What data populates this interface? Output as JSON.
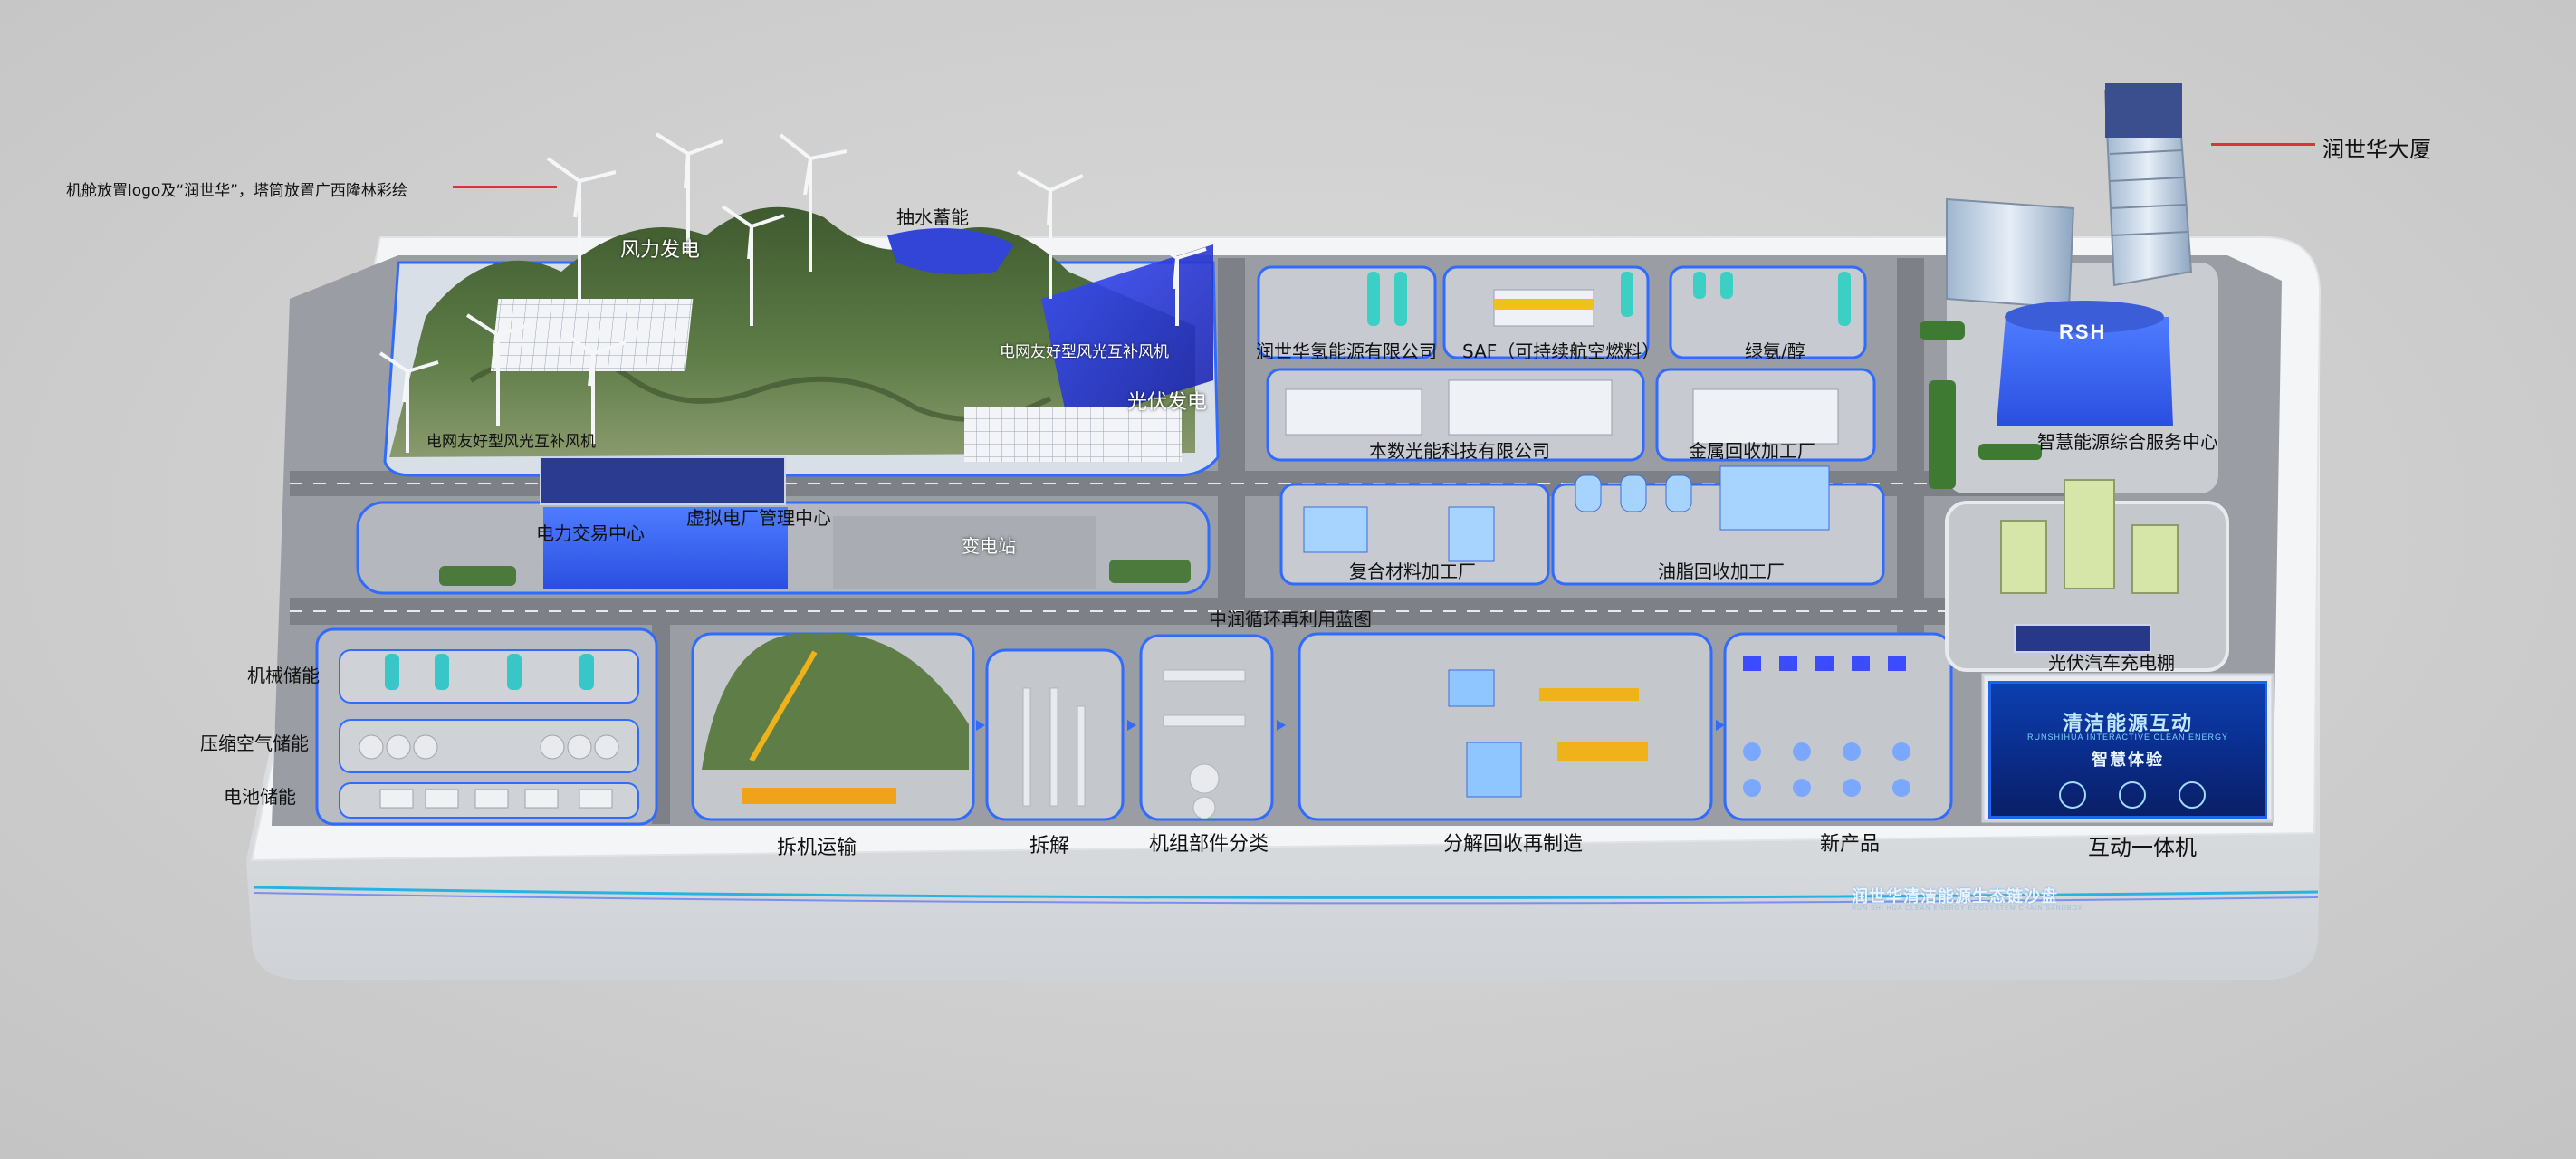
{
  "annotations": {
    "nacelle_note": "机舱放置logo及“润世华”，塔筒放置广西隆林彩绘",
    "building_callout": "润世华大厦"
  },
  "zones": {
    "wind_power": "风力发电",
    "pumped_storage": "抽水蓄能",
    "grid_friendly_wind_1": "电网友好型风光互补风机",
    "grid_friendly_wind_2": "电网友好型风光互补风机",
    "solar_power": "光伏发电",
    "power_trading_center": "电力交易中心",
    "virtual_power_plant": "虚拟电厂管理中心",
    "substation": "变电站",
    "hydrogen_company": "润世华氢能源有限公司",
    "saf": "SAF（可持续航空燃料）",
    "green_ammonia": "绿氨/醇",
    "photovoltaic_company": "本数光能科技有限公司",
    "metal_recycling": "金属回收加工厂",
    "composite_processing": "复合材料加工厂",
    "oil_recycling": "油脂回收加工厂",
    "smart_energy_center": "智慧能源综合服务中心",
    "solar_carport": "光伏汽车充电棚",
    "circular_blueprint": "中润循环再利用蓝图",
    "mechanical_storage": "机械储能",
    "compressed_air_storage": "压缩空气储能",
    "battery_storage": "电池储能"
  },
  "bottom_labels": {
    "dismantle_transport": "拆机运输",
    "dismantle": "拆解",
    "component_sorting": "机组部件分类",
    "recycling_manufacturing": "分解回收再制造",
    "new_products": "新产品",
    "interactive_kiosk": "互动一体机"
  },
  "building_sign": "RSH",
  "screen": {
    "title": "清洁能源互动",
    "subtitle": "RUNSHIHUA INTERACTIVE CLEAN ENERGY",
    "caption": "智慧体验"
  },
  "brand_strip": {
    "name": "润世华清洁能源生态链沙盘",
    "english": "RUN SHI HUA CLEAN ENERGY ECOSYSTEM CHAIN SANDBOX"
  },
  "colors": {
    "table_white": "#f4f5f7",
    "accent_blue": "#1f5cff",
    "road": "#8d9096",
    "mountain_green": "#4f6f3c",
    "callout_red": "#d8343a",
    "solar_blue": "#2a3fd8"
  }
}
